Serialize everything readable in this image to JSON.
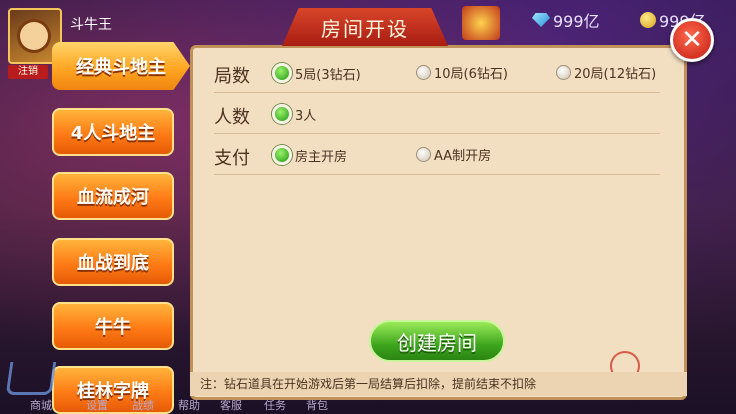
{
  "player": {
    "name": "斗牛王",
    "cancel_label": "注销"
  },
  "currency": {
    "diamonds": "999亿",
    "coins": "999亿"
  },
  "game_tabs": [
    {
      "label": "经典斗地主",
      "active": true
    },
    {
      "label": "4人斗地主",
      "active": false
    },
    {
      "label": "血流成河",
      "active": false
    },
    {
      "label": "血战到底",
      "active": false
    },
    {
      "label": "牛牛",
      "active": false
    },
    {
      "label": "桂林字牌",
      "active": false
    }
  ],
  "dialog": {
    "title": "房间开设",
    "rows": [
      {
        "label": "局数",
        "options": [
          {
            "label": "5局(3钻石)",
            "selected": true
          },
          {
            "label": "10局(6钻石)",
            "selected": false
          },
          {
            "label": "20局(12钻石)",
            "selected": false
          }
        ]
      },
      {
        "label": "人数",
        "options": [
          {
            "label": "3人",
            "selected": true
          }
        ]
      },
      {
        "label": "支付",
        "options": [
          {
            "label": "房主开房",
            "selected": true
          },
          {
            "label": "AA制开房",
            "selected": false
          }
        ]
      }
    ],
    "create_label": "创建房间",
    "note": "注：钻石道具在开始游戏后第一局结算后扣除，提前结束不扣除"
  },
  "bottom_nav": [
    "商城",
    "设置",
    "战绩",
    "帮助",
    "客服",
    "任务",
    "背包"
  ]
}
